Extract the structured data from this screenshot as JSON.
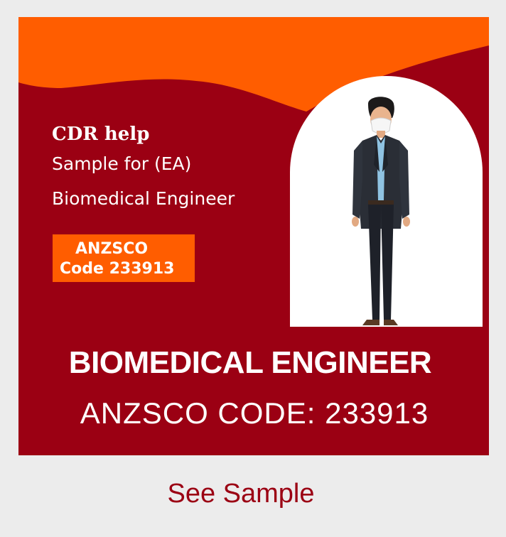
{
  "card": {
    "banner": {
      "brand": "CDR  help",
      "line1": "Sample for (EA)",
      "line2": "Biomedical Engineer",
      "anzsco_line1": "ANZSCO",
      "anzsco_line2": "Code 233913"
    },
    "title": "BIOMEDICAL ENGINEER",
    "code": "ANZSCO CODE: 233913"
  },
  "link": {
    "label": "See Sample"
  },
  "colors": {
    "brand_red": "#9b0013",
    "accent_orange": "#ff5d00",
    "page_bg": "#ececec"
  }
}
